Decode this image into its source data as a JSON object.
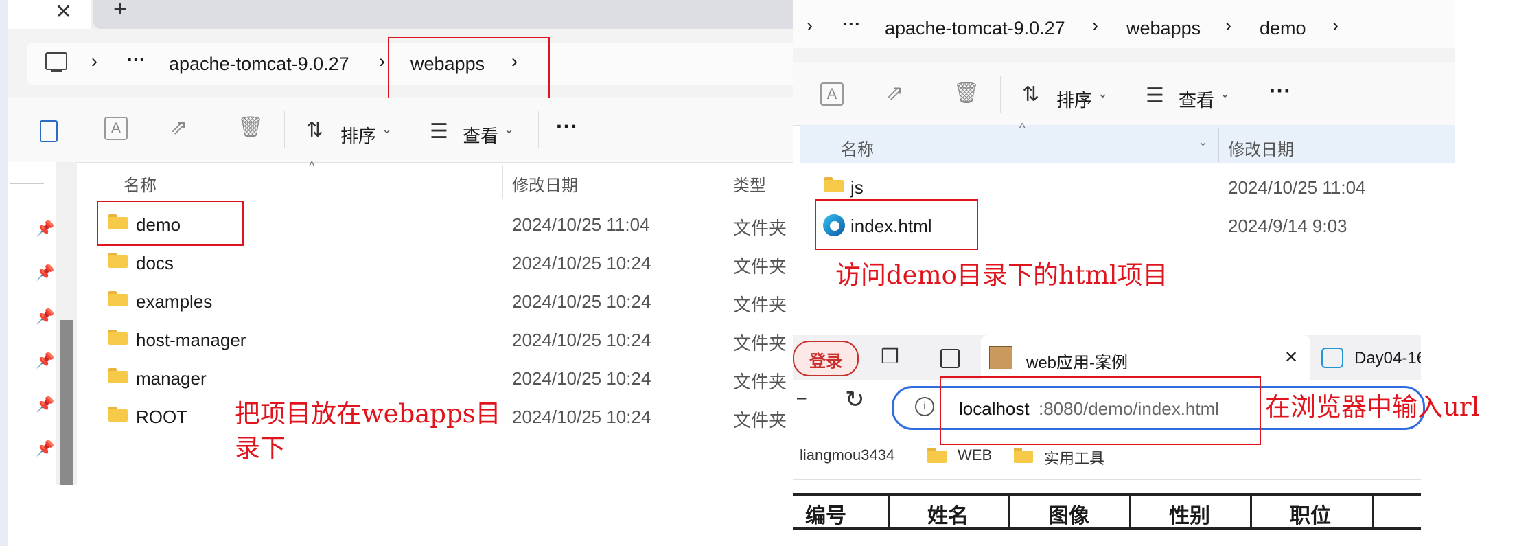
{
  "left": {
    "tab_close_icon": "close-icon",
    "tab_new_icon": "plus-icon",
    "breadcrumb": {
      "more": "···",
      "items": [
        "apache-tomcat-9.0.27",
        "webapps"
      ],
      "sep": "›"
    },
    "toolbar": {
      "sort_label": "排序",
      "view_label": "查看",
      "more": "···"
    },
    "columns": {
      "name": "名称",
      "date": "修改日期",
      "type": "类型"
    },
    "rows": [
      {
        "name": "demo",
        "date": "2024/10/25 11:04",
        "type": "文件夹"
      },
      {
        "name": "docs",
        "date": "2024/10/25 10:24",
        "type": "文件夹"
      },
      {
        "name": "examples",
        "date": "2024/10/25 10:24",
        "type": "文件夹"
      },
      {
        "name": "host-manager",
        "date": "2024/10/25 10:24",
        "type": "文件夹"
      },
      {
        "name": "manager",
        "date": "2024/10/25 10:24",
        "type": "文件夹"
      },
      {
        "name": "ROOT",
        "date": "2024/10/25 10:24",
        "type": "文件夹"
      }
    ],
    "annotation": "把项目放在webapps目录下"
  },
  "right": {
    "breadcrumb": {
      "more": "···",
      "items": [
        "apache-tomcat-9.0.27",
        "webapps",
        "demo"
      ],
      "sep": "›"
    },
    "toolbar": {
      "sort_label": "排序",
      "view_label": "查看",
      "more": "···"
    },
    "columns": {
      "name": "名称",
      "date": "修改日期"
    },
    "rows": [
      {
        "name": "js",
        "date": "2024/10/25 11:04"
      },
      {
        "name": "index.html",
        "date": "2024/9/14 9:03"
      }
    ],
    "annotation": "访问demo目录下的html项目"
  },
  "browser": {
    "login_label": "登录",
    "tab_title": "web应用-案例",
    "tab2_title": "Day04-16",
    "url_host": "localhost",
    "url_path": ":8080/demo/index.html",
    "bookmarks": [
      "liangmou3434",
      "WEB",
      "实用工具"
    ],
    "annotation": "在浏览器中输入url",
    "table_headers": [
      "编号",
      "姓名",
      "图像",
      "性别",
      "职位"
    ]
  }
}
